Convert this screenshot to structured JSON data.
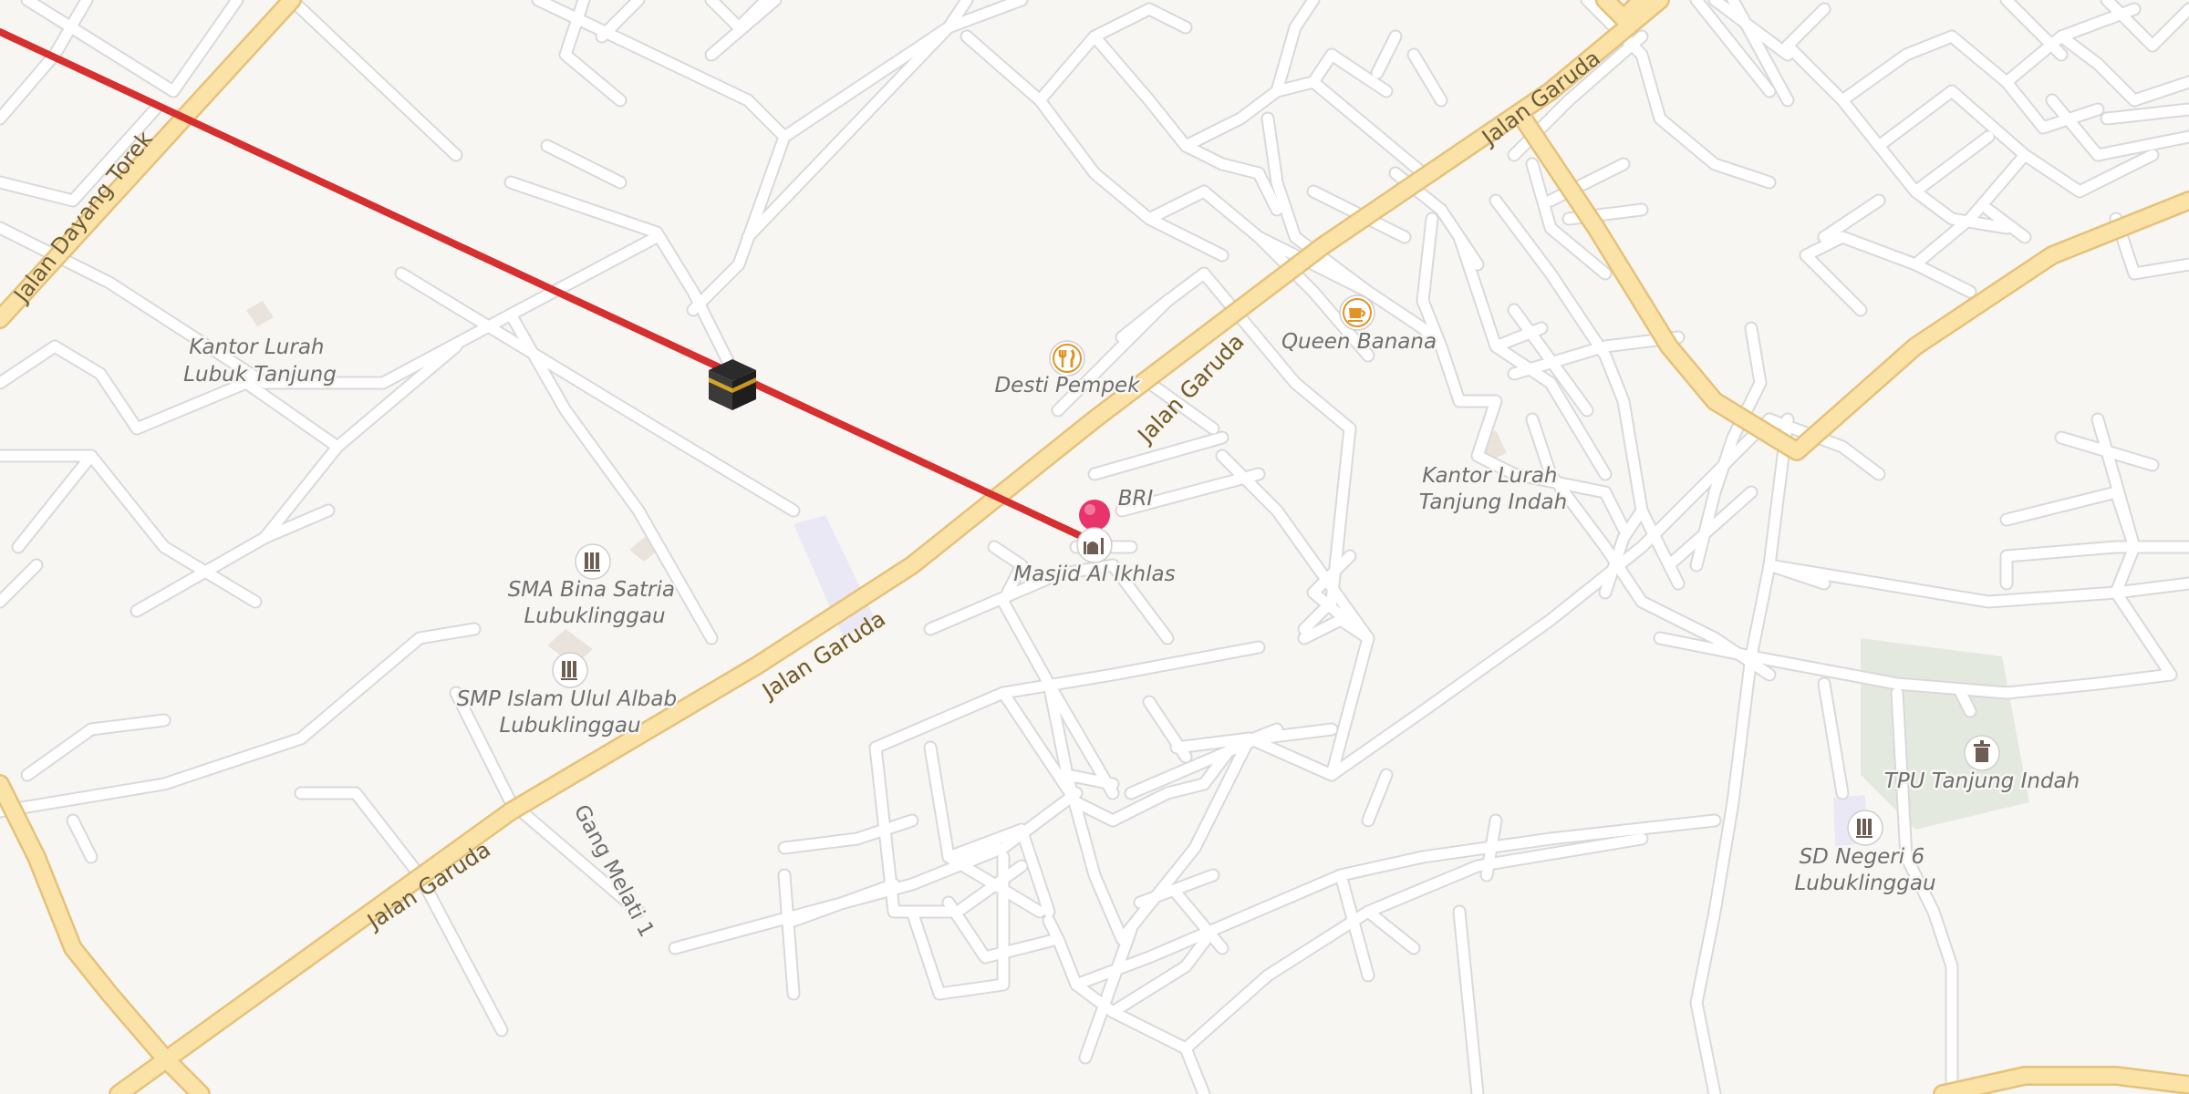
{
  "map": {
    "roads": {
      "jalan_garuda_1": "Jalan Garuda",
      "jalan_garuda_2": "Jalan Garuda",
      "jalan_garuda_3": "Jalan Garuda",
      "jalan_garuda_4": "Jalan Garuda",
      "jalan_dayang_torek": "Jalan Dayang Torek",
      "gang_melati": "Gang Melati 1"
    },
    "places": {
      "kantor_lurah_lubuk_tanjung": [
        "Kantor Lurah",
        "Lubuk Tanjung"
      ],
      "desti_pempek": "Desti Pempek",
      "queen_banana": "Queen Banana",
      "bri": "BRI",
      "masjid": "Masjid Al Ikhlas",
      "kantor_lurah_tanjung_indah": [
        "Kantor Lurah",
        "Tanjung Indah"
      ],
      "sma_bina_satria": [
        "SMA Bina Satria",
        "Lubuklinggau"
      ],
      "smp_islam": [
        "SMP Islam Ulul Albab",
        "Lubuklinggau"
      ],
      "tpu": "TPU Tanjung Indah",
      "sd_negeri_6": [
        "SD Negeri 6",
        "Lubuklinggau"
      ]
    },
    "icons": {
      "qibla_marker": "kaaba-icon",
      "location_pin": "map-pin-icon",
      "restaurant": "fork-knife-icon",
      "cafe": "coffee-cup-icon",
      "school": "school-icon",
      "cemetery": "cemetery-icon",
      "mosque": "mosque-icon"
    },
    "colors": {
      "background": "#f8f6f3",
      "qibla_line": "#d62f2f",
      "primary_road": "#fbe2a6",
      "minor_road": "#ffffff",
      "pin": "#e8336b"
    }
  }
}
